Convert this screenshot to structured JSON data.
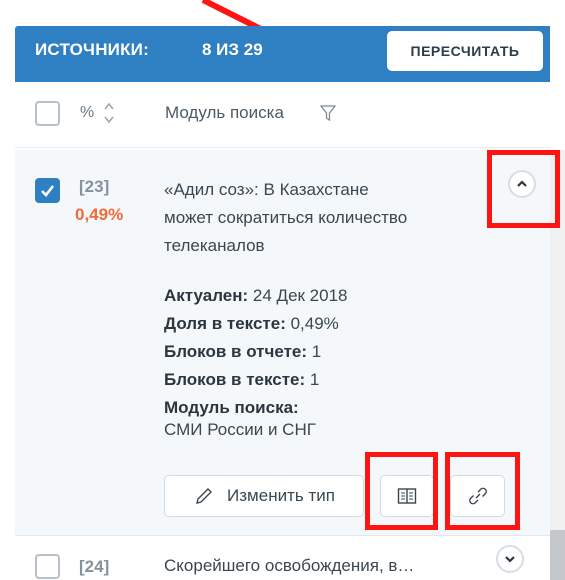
{
  "header": {
    "label": "ИСТОЧНИКИ:",
    "count": "8 ИЗ 29",
    "recalc_button": "ПЕРЕСЧИТАТЬ"
  },
  "columns": {
    "percent": "%",
    "module": "Модуль поиска"
  },
  "sources": [
    {
      "number": "[23]",
      "percent": "0,49%",
      "checked": true,
      "expanded": true,
      "title_lines": [
        "«Адил соз»: В Казахстане",
        "может сократиться количество",
        "телеканалов"
      ],
      "details": {
        "actual_label": "Актуален:",
        "actual_value": "24 Дек 2018",
        "share_label": "Доля в тексте:",
        "share_value": "0,49%",
        "blocks_report_label": "Блоков в отчете:",
        "blocks_report_value": "1",
        "blocks_text_label": "Блоков в тексте:",
        "blocks_text_value": "1",
        "module_label": "Модуль поиска:",
        "module_value": "СМИ России и СНГ"
      },
      "change_type_button": "Изменить тип"
    },
    {
      "number": "[24]",
      "checked": false,
      "expanded": false,
      "title": "Скорейшего освобождения, в…"
    }
  ],
  "colors": {
    "header_blue": "#2f7fc3",
    "percent_orange": "#f26a3a",
    "annotation_red": "#ff1414"
  }
}
